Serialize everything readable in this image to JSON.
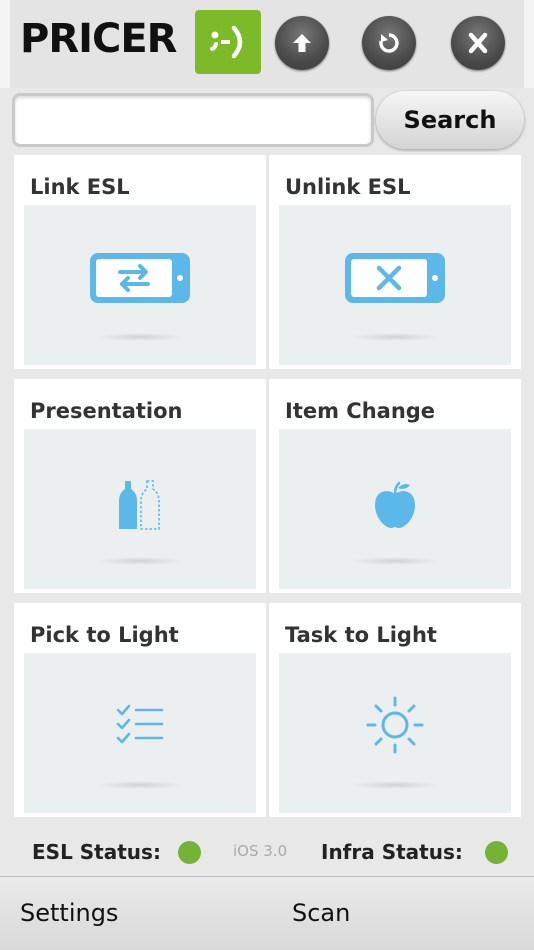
{
  "header": {
    "logo_text": "PRICER",
    "logo_mark": ";-)",
    "buttons": [
      {
        "name": "upload-button",
        "icon": "arrow-up-icon"
      },
      {
        "name": "refresh-button",
        "icon": "refresh-icon"
      },
      {
        "name": "close-button",
        "icon": "close-x-icon"
      }
    ]
  },
  "search": {
    "value": "",
    "placeholder": "",
    "button_label": "Search"
  },
  "tiles": [
    {
      "label": "Link ESL",
      "icon": "link-esl-icon"
    },
    {
      "label": "Unlink ESL",
      "icon": "unlink-esl-icon"
    },
    {
      "label": "Presentation",
      "icon": "bottles-icon"
    },
    {
      "label": "Item Change",
      "icon": "apple-icon"
    },
    {
      "label": "Pick to Light",
      "icon": "checklist-icon"
    },
    {
      "label": "Task to Light",
      "icon": "sun-icon"
    }
  ],
  "status": {
    "esl_label": "ESL Status:",
    "version": "iOS 3.0",
    "infra_label": "Infra Status:",
    "esl_color": "#74b336",
    "infra_color": "#74b336"
  },
  "tabbar": {
    "settings_label": "Settings",
    "scan_label": "Scan"
  },
  "colors": {
    "brand_green": "#7dba29",
    "icon_blue": "#5bb8e8"
  }
}
